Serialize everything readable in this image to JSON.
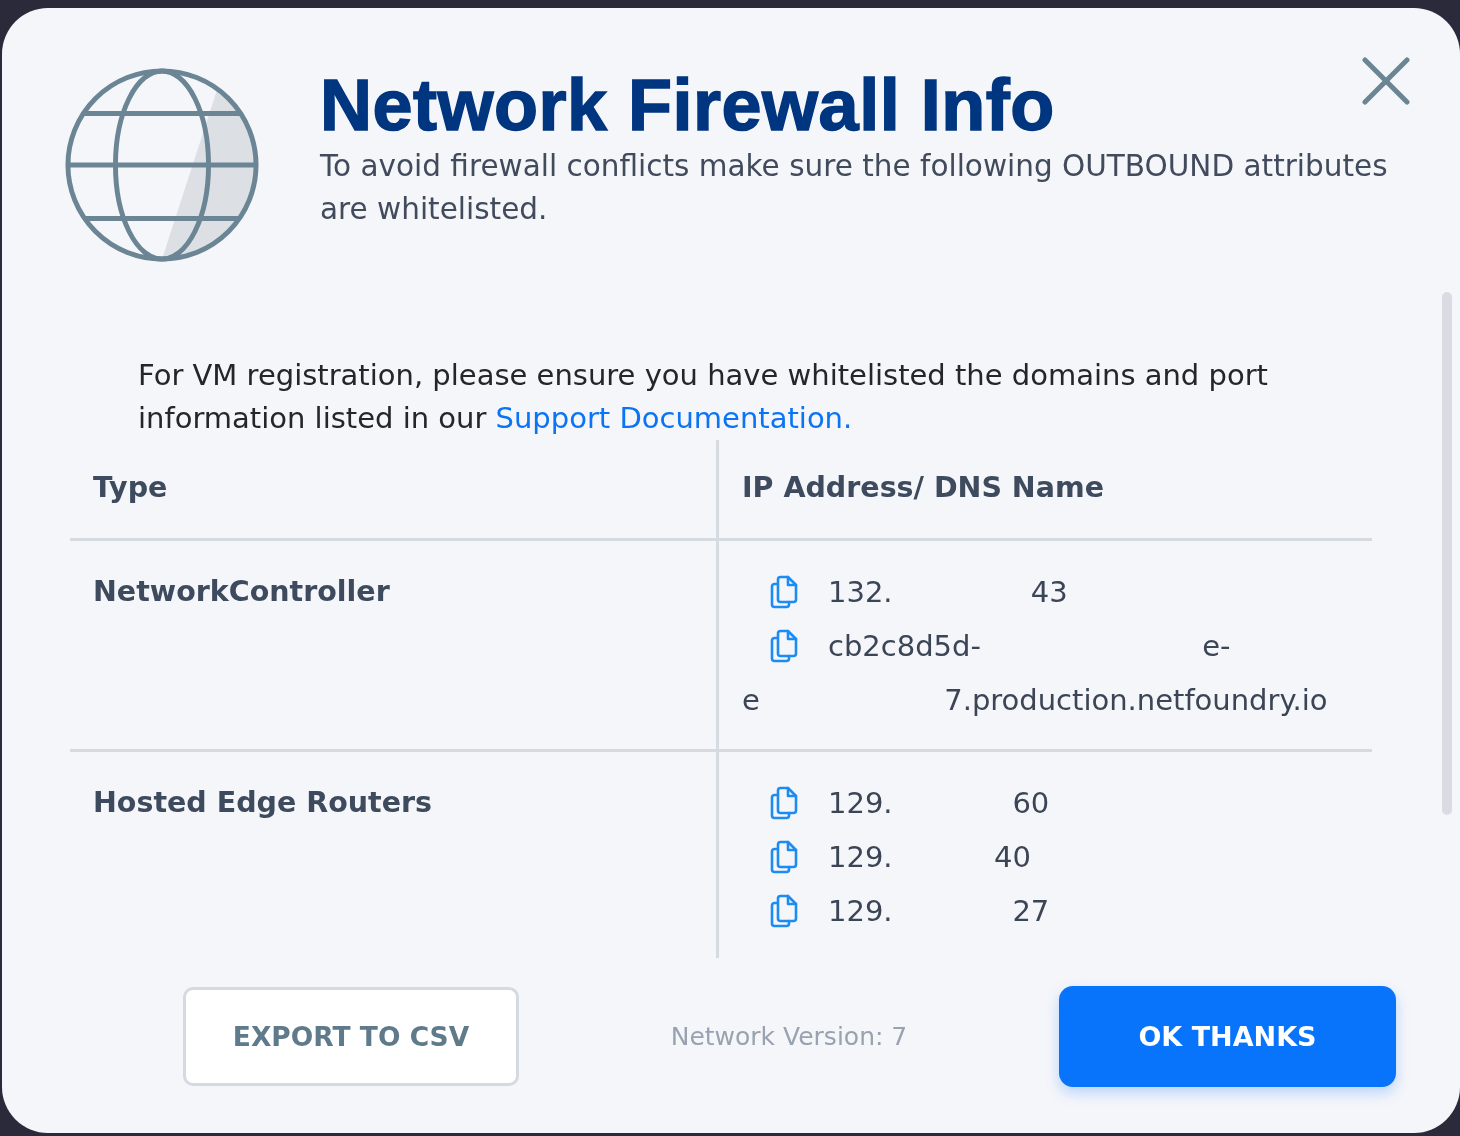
{
  "dialog": {
    "title": "Network Firewall Info",
    "subtitle": "To avoid firewall conflicts make sure the following OUTBOUND attributes are whitelisted."
  },
  "notice": {
    "text": "For VM registration, please ensure you have whitelisted the domains and port information listed in our",
    "link": "Support Documentation."
  },
  "table": {
    "columns": [
      "Type",
      "IP Address/ DNS Name"
    ],
    "rows": [
      {
        "type": "NetworkController",
        "addresses": [
          {
            "lines": [
              "132.               43"
            ]
          },
          {
            "lines": [
              "cb2c8d5d-                        e-",
              "e                    7.production.netfoundry.io"
            ]
          }
        ]
      },
      {
        "type": "Hosted Edge Routers",
        "addresses": [
          {
            "lines": [
              "129.             60"
            ]
          },
          {
            "lines": [
              "129.           40"
            ]
          },
          {
            "lines": [
              "129.             27"
            ]
          }
        ]
      }
    ]
  },
  "footer": {
    "export_button": "EXPORT TO CSV",
    "version": "Network Version: 7",
    "ok_button": "OK THANKS"
  }
}
